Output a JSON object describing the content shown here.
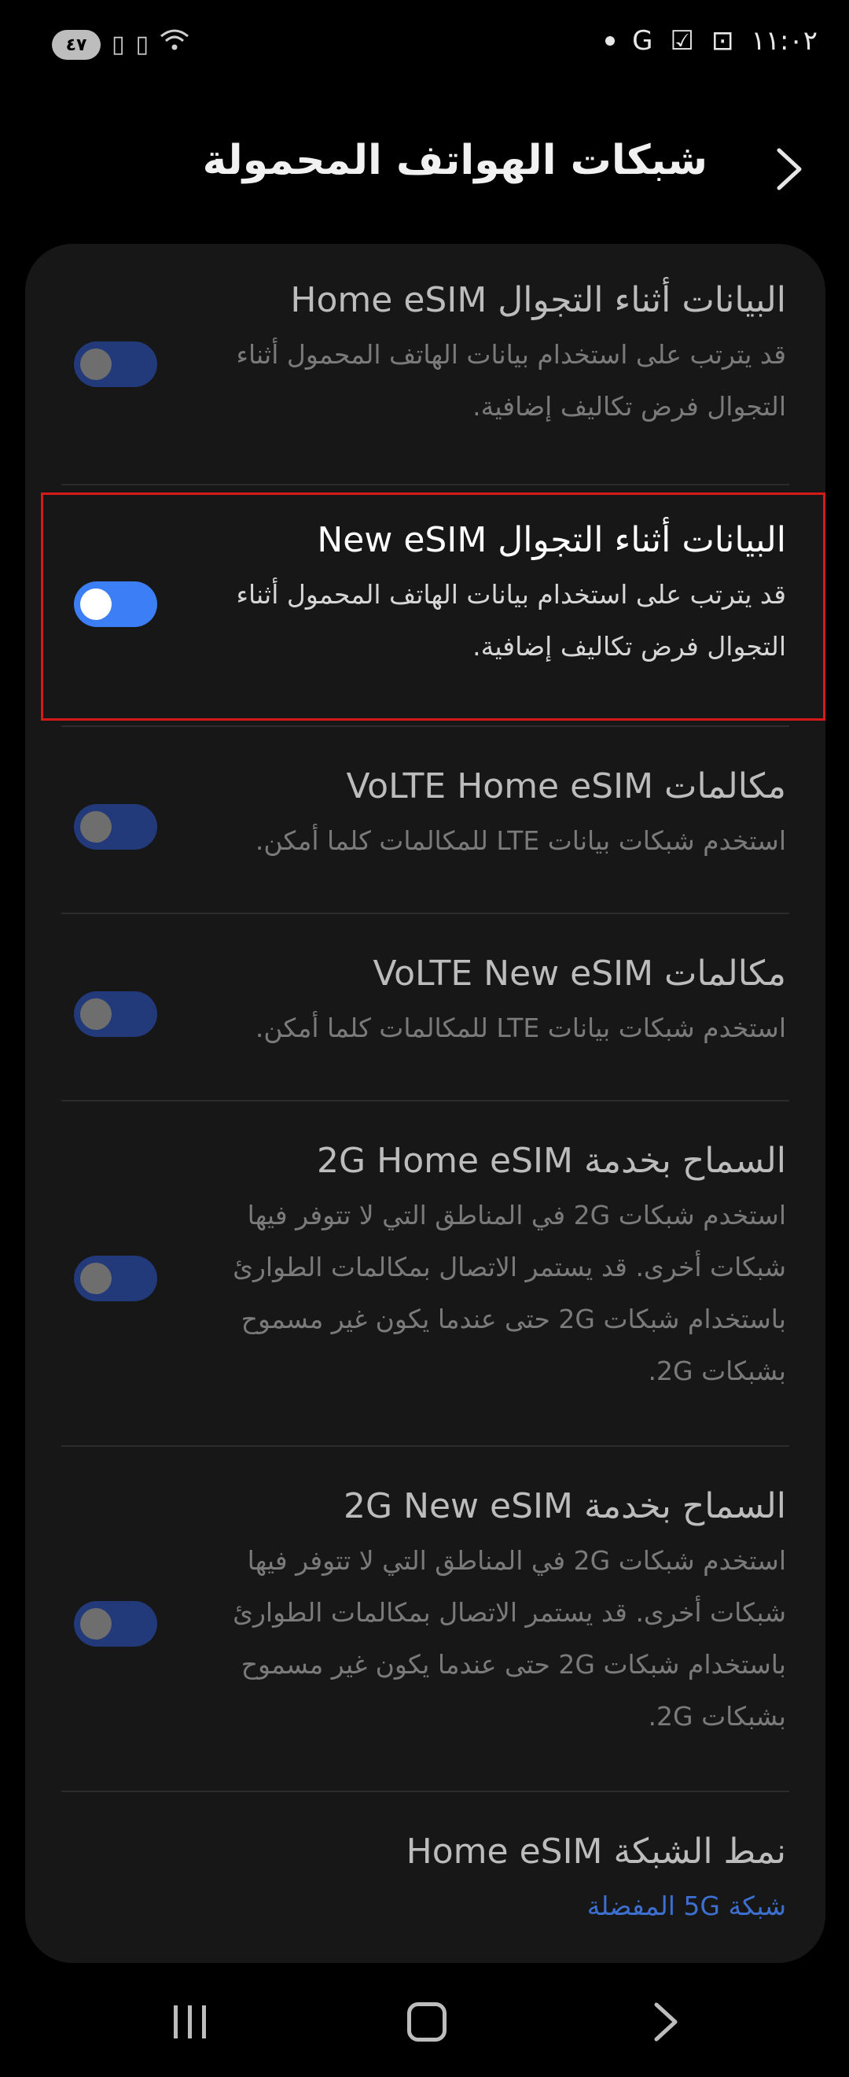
{
  "status_bar": {
    "battery": "٤٧",
    "time": "١١:٠٢",
    "left_icons": [
      "signal-r-icon",
      "signal-r-icon",
      "wifi-icon"
    ],
    "right_icons": [
      "dot-icon",
      "google-icon",
      "check-icon",
      "screenshot-icon"
    ]
  },
  "header": {
    "title": "شبكات الهواتف المحمولة",
    "back_icon": "chevron-icon"
  },
  "settings": [
    {
      "title": "البيانات أثناء التجوال Home eSIM",
      "subtitle": "قد يترتب على استخدام بيانات الهاتف المحمول أثناء التجوال فرض تكاليف إضافية.",
      "toggle_on": false
    },
    {
      "title": "البيانات أثناء التجوال New eSIM",
      "subtitle": "قد يترتب على استخدام بيانات الهاتف المحمول أثناء التجوال فرض تكاليف إضافية.",
      "toggle_on": true
    },
    {
      "title": "مكالمات VoLTE Home eSIM",
      "subtitle": "استخدم شبكات بيانات LTE للمكالمات كلما أمكن.",
      "toggle_on": false
    },
    {
      "title": "مكالمات VoLTE New eSIM",
      "subtitle": "استخدم شبكات بيانات LTE للمكالمات كلما أمكن.",
      "toggle_on": false
    },
    {
      "title": "السماح بخدمة 2G Home eSIM",
      "subtitle": "استخدم شبكات 2G في المناطق التي لا تتوفر فيها شبكات أخرى. قد يستمر الاتصال بمكالمات الطوارئ باستخدام شبكات 2G حتى عندما يكون غير مسموح بشبكات 2G.",
      "toggle_on": false
    },
    {
      "title": "السماح بخدمة 2G New eSIM",
      "subtitle": "استخدم شبكات 2G في المناطق التي لا تتوفر فيها شبكات أخرى. قد يستمر الاتصال بمكالمات الطوارئ باستخدام شبكات 2G حتى عندما يكون غير مسموح بشبكات 2G.",
      "toggle_on": false
    },
    {
      "title": "نمط الشبكة Home eSIM",
      "subtitle": "شبكة 5G المفضلة"
    }
  ],
  "colors": {
    "accent": "#3b7ef5",
    "highlight": "#d51a1a",
    "link": "#3d6fcf"
  },
  "nav": {
    "recents_icon": "recents-icon",
    "home_icon": "home-icon",
    "back_icon": "back-icon"
  }
}
